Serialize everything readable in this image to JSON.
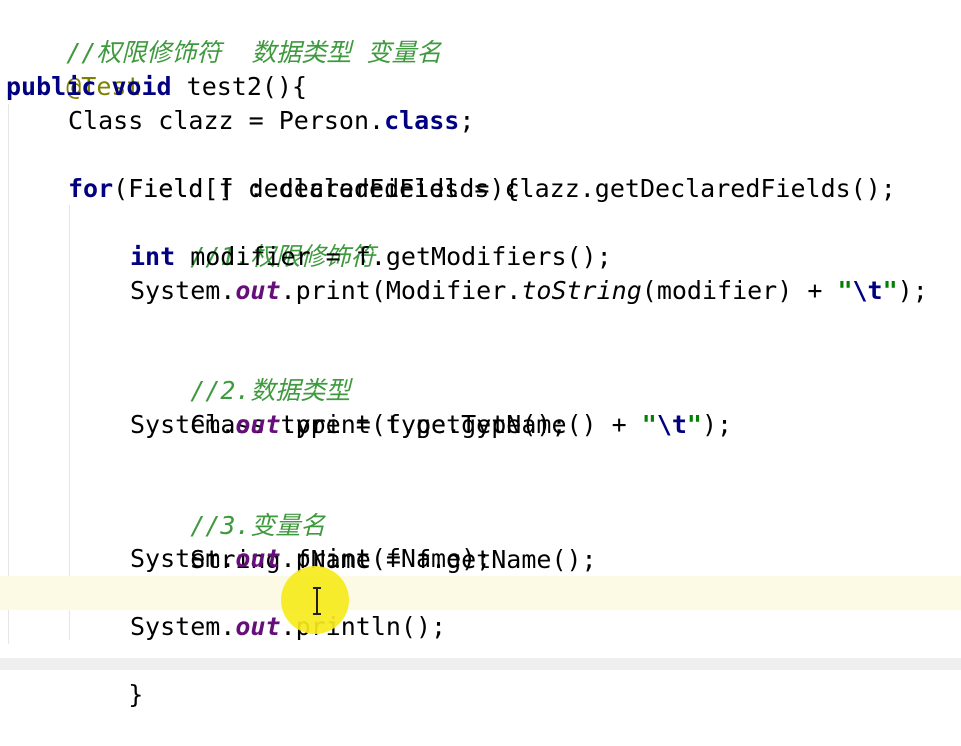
{
  "code": {
    "line1": {
      "comment": "//权限修饰符  数据类型 变量名"
    },
    "line2": {
      "annotation": "@Test"
    },
    "line3": {
      "kw_public": "public",
      "kw_void": "void",
      "rest": " test2(){"
    },
    "line4": {
      "pre": "Class clazz = Person.",
      "kw_class": "class",
      "post": ";"
    },
    "line5": {
      "text": "Field[] declaredFields = clazz.getDeclaredFields();"
    },
    "line6": {
      "kw_for": "for",
      "rest": "(Field f : declaredFields){"
    },
    "line7": {
      "comment": "//1.权限修饰符"
    },
    "line8": {
      "kw_int": "int",
      "rest": " modifier = f.getModifiers();"
    },
    "line9": {
      "pre": "System.",
      "field": "out",
      "mid": ".print(Modifier.",
      "method": "toString",
      "mid2": "(modifier) + ",
      "q1": "\"",
      "esc": "\\t",
      "q2": "\"",
      "post": ");"
    },
    "line11": {
      "comment": "//2.数据类型"
    },
    "line12": {
      "text": "Class type = f.getType();"
    },
    "line13": {
      "pre": "System.",
      "field": "out",
      "mid": ".print(type.getName() + ",
      "q1": "\"",
      "esc": "\\t",
      "q2": "\"",
      "post": ");"
    },
    "line15": {
      "comment": "//3.变量名"
    },
    "line16": {
      "text": "String fName = f.getName();"
    },
    "line17": {
      "pre": "System.",
      "field": "out",
      "post": ".print(fName);"
    },
    "line19": {
      "pre": "System.",
      "field": "out",
      "post": ".println();"
    },
    "line20": {
      "text": "}"
    }
  },
  "colors": {
    "comment": "#3f9a3f",
    "keyword": "#000080",
    "annotation": "#808000",
    "static_field": "#660e7a",
    "caret_line": "#fcfae4",
    "cursor_highlight": "#f6ea1c"
  },
  "icons": {
    "cursor": "text-cursor-ibeam-icon"
  }
}
